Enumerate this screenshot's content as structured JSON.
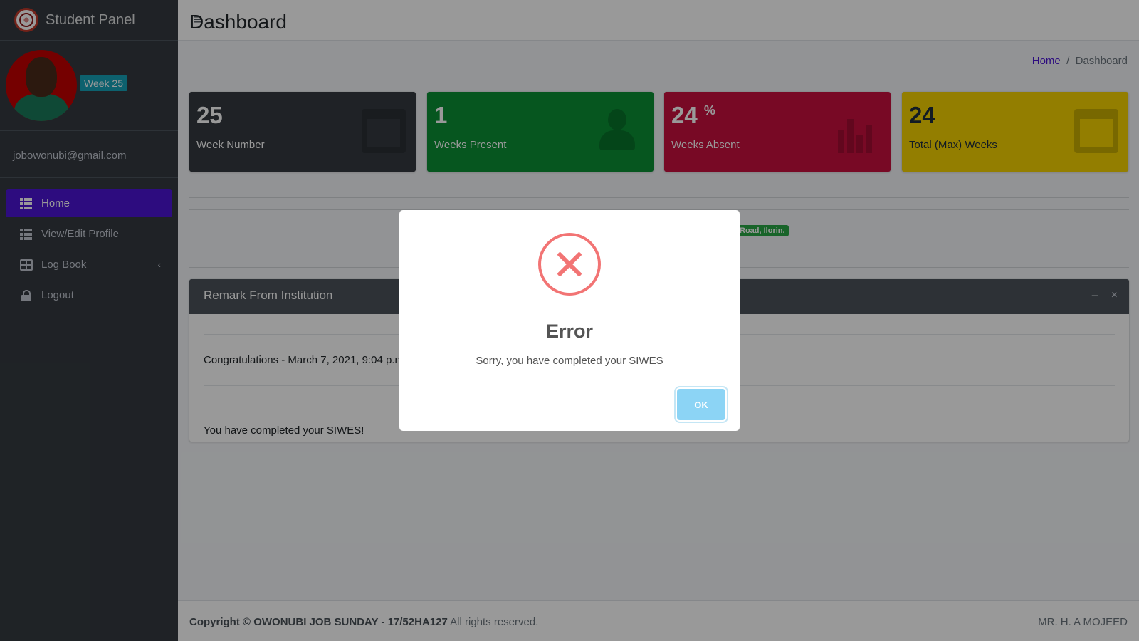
{
  "sidebar": {
    "brand": "Student Panel",
    "week_badge": "Week 25",
    "email": "jobowonubi@gmail.com",
    "items": [
      {
        "label": "Home",
        "icon": "grid-icon",
        "active": true
      },
      {
        "label": "View/Edit Profile",
        "icon": "grid-icon"
      },
      {
        "label": "Log Book",
        "icon": "table-icon",
        "chevron": "‹"
      },
      {
        "label": "Logout",
        "icon": "lock-icon"
      }
    ]
  },
  "topbar": {
    "menu_icon": "≡"
  },
  "header": {
    "title": "Dashboard",
    "breadcrumb": {
      "home": "Home",
      "separator": "/",
      "current": "Dashboard"
    }
  },
  "stats": [
    {
      "value": "25",
      "label": "Week Number",
      "color": "#343a40",
      "icon": "calendar-icon"
    },
    {
      "value": "1",
      "label": "Weeks Present",
      "color": "#0a8f35",
      "icon": "user-plus-icon"
    },
    {
      "value": "24",
      "suffix": "%",
      "label": "Weeks Absent",
      "color": "#c8103f",
      "icon": "bar-chart-icon"
    },
    {
      "value": "24",
      "label": "Total (Max) Weeks",
      "color": "#f5d300",
      "icon": "calendar-icon"
    }
  ],
  "address_badge": "Road, Ilorin.",
  "remark_card": {
    "title": "Remark From Institution",
    "minimize": "–",
    "close": "×",
    "entry_title": "Congratulations - March 7, 2021, 9:04 p.m.",
    "entry_text": "You have completed your SIWES!"
  },
  "footer": {
    "copyright_prefix": "Copyright © OWONUBI JOB SUNDAY - 17/52HA127",
    "copyright_suffix": " All rights reserved.",
    "right": "MR. H. A MOJEED"
  },
  "modal": {
    "title": "Error",
    "text": "Sorry, you have completed your SIWES",
    "button": "OK",
    "accent": "#f27474"
  }
}
